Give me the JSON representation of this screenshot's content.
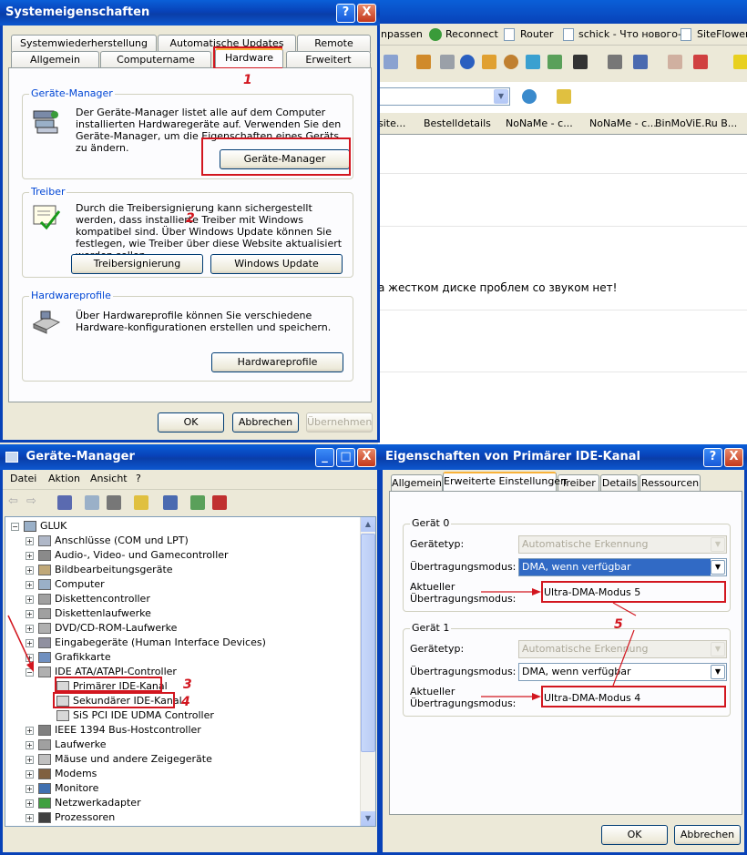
{
  "browser": {
    "bookmarks": [
      "npassen",
      "Reconnect",
      "Router",
      "schick - Что нового-",
      "SiteFlower"
    ],
    "tabs": [
      "site...",
      "Bestelldetails",
      "NoNaMe - c...",
      "NoNaMe - c...",
      "BinMoViE.Ru B..."
    ],
    "content_line": "а жестком диске проблем со звуком нет!"
  },
  "sysprops": {
    "title": "Systemeigenschaften",
    "help": "?",
    "close": "X",
    "tabs_top": [
      "Systemwiederherstellung",
      "Automatische Updates",
      "Remote"
    ],
    "tabs_bottom": [
      "Allgemein",
      "Computername",
      "Hardware",
      "Erweitert"
    ],
    "active_tab": "Hardware",
    "groups": {
      "devmgr": {
        "label": "Geräte-Manager",
        "text": "Der Geräte-Manager listet alle auf dem Computer installierten Hardwaregeräte auf. Verwenden Sie den Geräte-Manager, um die Eigenschaften eines Geräts zu ändern.",
        "button": "Geräte-Manager"
      },
      "drivers": {
        "label": "Treiber",
        "text": "Durch die Treibersignierung kann sichergestellt werden, dass installierte Treiber mit Windows kompatibel sind. Über Windows Update können Sie festlegen, wie Treiber über diese Website aktualisiert werden sollen.",
        "button1": "Treibersignierung",
        "button2": "Windows Update"
      },
      "hwprofiles": {
        "label": "Hardwareprofile",
        "text": "Über Hardwareprofile können Sie verschiedene Hardware-konfigurationen erstellen und speichern.",
        "button": "Hardwareprofile"
      }
    },
    "ok": "OK",
    "cancel": "Abbrechen",
    "apply": "Übernehmen"
  },
  "devmgr": {
    "title": "Geräte-Manager",
    "min": "_",
    "max": "□",
    "close": "X",
    "menu": [
      "Datei",
      "Aktion",
      "Ansicht",
      "?"
    ],
    "root": "GLUK",
    "items": [
      "Anschlüsse (COM und LPT)",
      "Audio-, Video- und Gamecontroller",
      "Bildbearbeitungsgeräte",
      "Computer",
      "Diskettencontroller",
      "Diskettenlaufwerke",
      "DVD/CD-ROM-Laufwerke",
      "Eingabegeräte (Human Interface Devices)",
      "Grafikkarte",
      "IDE ATA/ATAPI-Controller"
    ],
    "ide_children": [
      "Primärer IDE-Kanal",
      "Sekundärer IDE-Kanal",
      "SiS PCI IDE UDMA Controller"
    ],
    "items_after": [
      "IEEE 1394 Bus-Hostcontroller",
      "Laufwerke",
      "Mäuse und andere Zeigegeräte",
      "Modems",
      "Monitore",
      "Netzwerkadapter",
      "Prozessoren"
    ]
  },
  "ideprops": {
    "title": "Eigenschaften von Primärer IDE-Kanal",
    "help": "?",
    "close": "X",
    "tabs": [
      "Allgemein",
      "Erweiterte Einstellungen",
      "Treiber",
      "Details",
      "Ressourcen"
    ],
    "active_tab": "Erweiterte Einstellungen",
    "device0": {
      "label": "Gerät 0",
      "type_label": "Gerätetyp:",
      "type_value": "Automatische Erkennung",
      "mode_label": "Übertragungsmodus:",
      "mode_value": "DMA, wenn verfügbar",
      "current_label1": "Aktueller",
      "current_label2": "Übertragungsmodus:",
      "current_value": "Ultra-DMA-Modus 5"
    },
    "device1": {
      "label": "Gerät 1",
      "type_label": "Gerätetyp:",
      "type_value": "Automatische Erkennung",
      "mode_label": "Übertragungsmodus:",
      "mode_value": "DMA, wenn verfügbar",
      "current_label1": "Aktueller",
      "current_label2": "Übertragungsmodus:",
      "current_value": "Ultra-DMA-Modus 4"
    },
    "ok": "OK",
    "cancel": "Abbrechen"
  },
  "annotations": [
    "1",
    "2",
    "3",
    "4",
    "5"
  ],
  "colors": {
    "titlebar": "#0842b8",
    "annotation": "#d2161f",
    "selection": "#316ac5",
    "group_label": "#0046d5"
  }
}
